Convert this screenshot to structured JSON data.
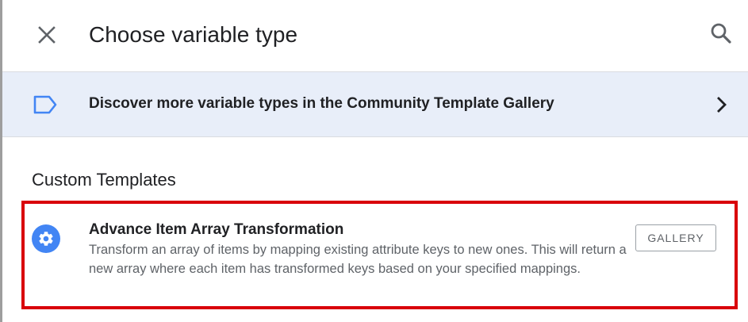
{
  "header": {
    "title": "Choose variable type",
    "close_icon": "close-icon",
    "search_icon": "search-icon"
  },
  "banner": {
    "text": "Discover more variable types in the Community Template Gallery",
    "icon": "tag-icon",
    "chevron_icon": "chevron-right-icon"
  },
  "custom_templates": {
    "section_title": "Custom Templates",
    "items": [
      {
        "title": "Advance Item Array Transformation",
        "description": "Transform an array of items by mapping existing attribute keys to new ones. This will return a new array where each item has transformed keys based on your specified mappings.",
        "icon": "gear-icon",
        "button_label": "GALLERY",
        "highlighted": true
      }
    ]
  },
  "colors": {
    "accent_blue": "#4285f4",
    "banner_bg": "#e8eef9",
    "highlight_red": "#d9000a",
    "text_primary": "#202124",
    "text_secondary": "#5f6368"
  }
}
